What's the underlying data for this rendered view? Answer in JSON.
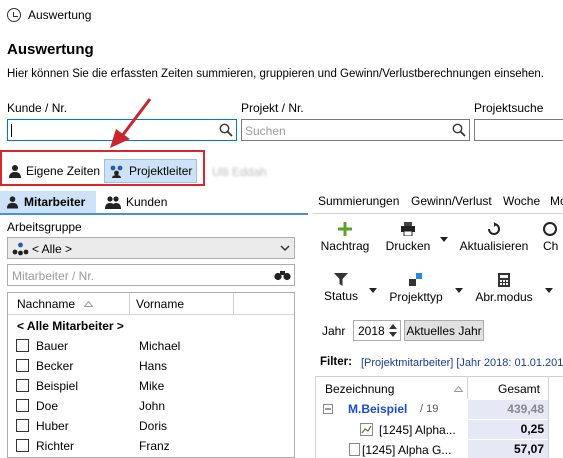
{
  "window": {
    "title": "Auswertung"
  },
  "page": {
    "title": "Auswertung",
    "description": "Hier können Sie die erfassten Zeiten summieren, gruppieren und Gewinn/Verlustberechnungen einsehen."
  },
  "filters": {
    "kunde_label": "Kunde / Nr.",
    "kunde_value": "",
    "projekt_label": "Projekt / Nr.",
    "projekt_placeholder": "Suchen",
    "projektsuche_label": "Projektsuche"
  },
  "mode": {
    "eigene_zeiten": "Eigene Zeiten",
    "projektleiter": "Projektleiter",
    "blurred_text": "Ulli Eddah"
  },
  "left_tabs": {
    "mitarbeiter": "Mitarbeiter",
    "kunden": "Kunden"
  },
  "arbeitsgruppe": {
    "label": "Arbeitsgruppe",
    "selected": "< Alle >"
  },
  "mitarbeiter_search": {
    "placeholder": "Mitarbeiter / Nr."
  },
  "employee_table": {
    "columns": [
      "Nachname",
      "Vorname"
    ],
    "all_row": "< Alle Mitarbeiter >",
    "rows": [
      {
        "nachname": "Bauer",
        "vorname": "Michael"
      },
      {
        "nachname": "Becker",
        "vorname": "Hans"
      },
      {
        "nachname": "Beispiel",
        "vorname": "Mike"
      },
      {
        "nachname": "Doe",
        "vorname": "John"
      },
      {
        "nachname": "Huber",
        "vorname": "Doris"
      },
      {
        "nachname": "Richter",
        "vorname": "Franz"
      }
    ]
  },
  "right_tabs": [
    "Summierungen",
    "Gewinn/Verlust",
    "Woche",
    "Mo"
  ],
  "toolbar1": {
    "nachtrag": "Nachtrag",
    "drucken": "Drucken",
    "aktualisieren": "Aktualisieren",
    "ch": "Ch"
  },
  "toolbar2": {
    "status": "Status",
    "projekttyp": "Projekttyp",
    "abrmodus": "Abr.modus"
  },
  "year": {
    "label": "Jahr",
    "value": "2018",
    "current_button": "Aktuelles Jahr"
  },
  "filter_line": {
    "label": "Filter:",
    "text": "[Projektmitarbeiter] [Jahr 2018: 01.01.201"
  },
  "result_table": {
    "columns": [
      "Bezeichnung",
      "Gesamt"
    ],
    "rows": [
      {
        "name": "M.Beispiel",
        "count": "/ 19",
        "gesamt": "439,48"
      },
      {
        "name": "[1245] Alpha...",
        "gesamt": "0,25"
      },
      {
        "name": "[1245] Alpha G...",
        "gesamt": "57,07"
      }
    ]
  },
  "colors": {
    "accent": "#0078d7",
    "highlight_red": "#d9262c",
    "selection_blue": "#cde2f6",
    "sum_bg": "#e6e9f5",
    "group_name": "#1a4bd1"
  }
}
